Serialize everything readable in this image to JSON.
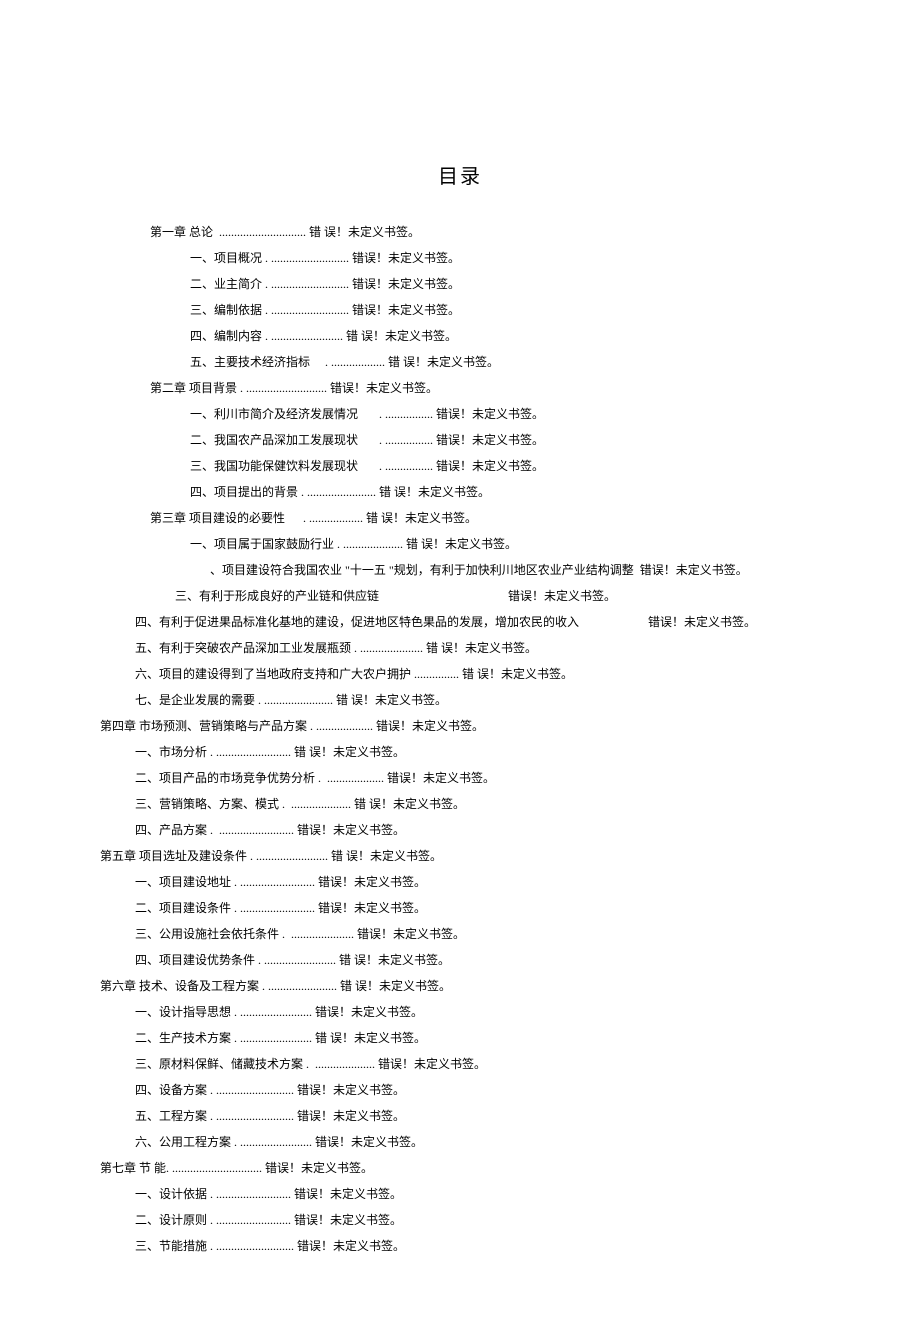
{
  "title": "目录",
  "error_text": "错误！未定义书签。",
  "error_text_spaced": "错 误！未定义书签。",
  "toc": [
    {
      "indent": 90,
      "text": "第一章 总论 ",
      "leader": " .............................",
      "suffix": "spaced"
    },
    {
      "indent": 130,
      "text": "一、项目概况 .",
      "leader": " ..........................",
      "suffix": "plain"
    },
    {
      "indent": 130,
      "text": "二、业主简介 .",
      "leader": " ..........................",
      "suffix": "plain"
    },
    {
      "indent": 130,
      "text": "三、编制依据 .",
      "leader": " ..........................",
      "suffix": "plain"
    },
    {
      "indent": 130,
      "text": "四、编制内容 .",
      "leader": " ........................",
      "suffix": "spaced"
    },
    {
      "indent": 130,
      "text": "五、主要技术经济指标",
      "leader": "     . ..................",
      "suffix": "spaced"
    },
    {
      "indent": 90,
      "text": "第二章 项目背景 .",
      "leader": " ...........................",
      "suffix": "plain"
    },
    {
      "indent": 130,
      "text": "一、利川市简介及经济发展情况",
      "leader": "       . ................",
      "suffix": "plain"
    },
    {
      "indent": 130,
      "text": "二、我国农产品深加工发展现状",
      "leader": "       . ................",
      "suffix": "plain"
    },
    {
      "indent": 130,
      "text": "三、我国功能保健饮料发展现状",
      "leader": "       . ................",
      "suffix": "plain"
    },
    {
      "indent": 130,
      "text": "四、项目提出的背景 .",
      "leader": " .......................",
      "suffix": "spaced"
    },
    {
      "indent": 90,
      "text": "第三章 项目建设的必要性",
      "leader": "      . ..................",
      "suffix": "spaced"
    },
    {
      "indent": 130,
      "text": "一、项目属于国家鼓励行业 .",
      "leader": " ....................",
      "suffix": "spaced"
    },
    {
      "indent": 150,
      "text": "、项目建设符合我国农业 \"十一五 \"规划，有利于加快利川地区农业产业结构调整",
      "leader": " ",
      "suffix": "plain"
    },
    {
      "indent": 115,
      "text": "三、有利于形成良好的产业链和供应链",
      "leader": "                                          ",
      "suffix": "plain"
    },
    {
      "indent": 75,
      "text": "四、有利于促进果品标准化基地的建设，促进地区特色果品的发展，增加农民的收入",
      "leader": "                      ",
      "suffix": "plain"
    },
    {
      "indent": 75,
      "text": "五、有利于突破农产品深加工业发展瓶颈",
      "leader": " . .....................",
      "suffix": "spaced"
    },
    {
      "indent": 75,
      "text": "六、项目的建设得到了当地政府支持和广大农户拥护",
      "leader": " ...............",
      "suffix": "spaced"
    },
    {
      "indent": 75,
      "text": "七、是企业发展的需要 .",
      "leader": " .......................",
      "suffix": "spaced"
    },
    {
      "indent": 40,
      "text": "第四章 市场预测、营销策略与产品方案 .",
      "leader": " ...................",
      "suffix": "plain"
    },
    {
      "indent": 75,
      "text": "一、市场分析 .",
      "leader": " .........................",
      "suffix": "spaced"
    },
    {
      "indent": 75,
      "text": "二、项目产品的市场竞争优势分析 .",
      "leader": "  ...................",
      "suffix": "plain"
    },
    {
      "indent": 75,
      "text": "三、营销策略、方案、模式 .",
      "leader": "  ....................",
      "suffix": "spaced"
    },
    {
      "indent": 75,
      "text": "四、产品方案 .",
      "leader": "  .........................",
      "suffix": "plain"
    },
    {
      "indent": 40,
      "text": "第五章 项目选址及建设条件 .",
      "leader": " ........................",
      "suffix": "spaced"
    },
    {
      "indent": 75,
      "text": "一、项目建设地址 .",
      "leader": " .........................",
      "suffix": "plain"
    },
    {
      "indent": 75,
      "text": "二、项目建设条件 .",
      "leader": " .........................",
      "suffix": "plain"
    },
    {
      "indent": 75,
      "text": "三、公用设施社会依托条件 .",
      "leader": "  .....................",
      "suffix": "plain"
    },
    {
      "indent": 75,
      "text": "四、项目建设优势条件 .",
      "leader": " ........................",
      "suffix": "spaced"
    },
    {
      "indent": 40,
      "text": "第六章 技术、设备及工程方案 .",
      "leader": " .......................",
      "suffix": "spaced"
    },
    {
      "indent": 75,
      "text": "一、设计指导思想 .",
      "leader": " ........................",
      "suffix": "plain"
    },
    {
      "indent": 75,
      "text": "二、生产技术方案 .",
      "leader": " ........................",
      "suffix": "spaced"
    },
    {
      "indent": 75,
      "text": "三、原材料保鲜、储藏技术方案 .",
      "leader": "  ....................",
      "suffix": "plain"
    },
    {
      "indent": 75,
      "text": "四、设备方案 .",
      "leader": " ..........................",
      "suffix": "plain"
    },
    {
      "indent": 75,
      "text": "五、工程方案 .",
      "leader": " ..........................",
      "suffix": "plain"
    },
    {
      "indent": 75,
      "text": "六、公用工程方案 .",
      "leader": " ........................",
      "suffix": "plain"
    },
    {
      "indent": 40,
      "text": "第七章 节 能.",
      "leader": " ..............................",
      "suffix": "plain"
    },
    {
      "indent": 75,
      "text": "一、设计依据 .",
      "leader": " .........................",
      "suffix": "plain"
    },
    {
      "indent": 75,
      "text": "二、设计原则 .",
      "leader": " .........................",
      "suffix": "plain"
    },
    {
      "indent": 75,
      "text": "三、节能措施 .",
      "leader": " ..........................",
      "suffix": "plain"
    }
  ]
}
